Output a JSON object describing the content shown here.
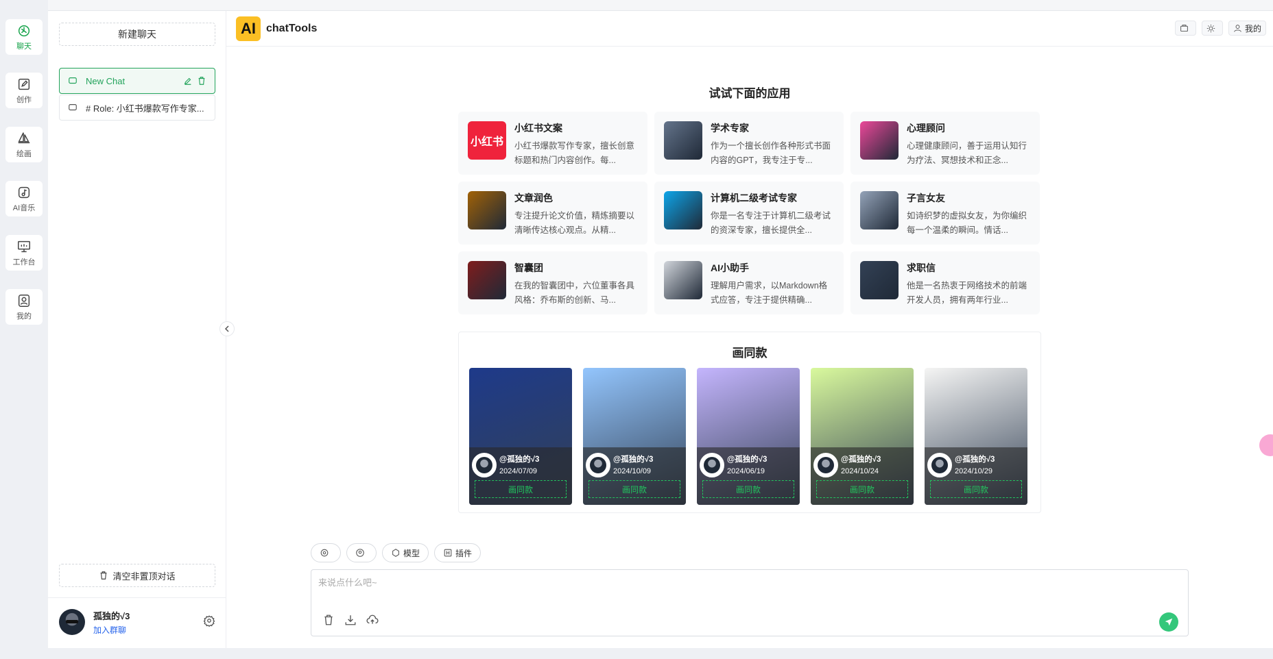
{
  "rail": {
    "items": [
      {
        "label": "聊天",
        "icon": "openai-chat-icon"
      },
      {
        "label": "创作",
        "icon": "edit-icon"
      },
      {
        "label": "绘画",
        "icon": "sailboat-icon"
      },
      {
        "label": "AI音乐",
        "icon": "music-note-icon"
      },
      {
        "label": "工作台",
        "icon": "dashboard-icon"
      },
      {
        "label": "我的",
        "icon": "user-icon"
      }
    ],
    "accent": "#16a34a"
  },
  "sidebar": {
    "new_chat": "新建聊天",
    "chats": [
      {
        "title": "New Chat",
        "active": true
      },
      {
        "title": "# Role: 小红书爆款写作专家..."
      }
    ],
    "clear_label": "清空非置顶对话",
    "user": {
      "name": "孤独的√3",
      "link": "加入群聊"
    }
  },
  "header": {
    "logo": "AI",
    "title": "chatTools",
    "actions": [
      {
        "label": ""
      },
      {
        "label": ""
      },
      {
        "label": "我的"
      }
    ]
  },
  "apps": {
    "title": "试试下面的应用",
    "items": [
      {
        "name": "小红书文案",
        "desc": "小红书爆款写作专家，擅长创意标题和热门内容创作。每...",
        "logo_text": "小红书",
        "color": "#ef233c"
      },
      {
        "name": "学术专家",
        "desc": "作为一个擅长创作各种形式书面内容的GPT，我专注于专...",
        "color": "#64748b"
      },
      {
        "name": "心理顾问",
        "desc": "心理健康顾问，善于运用认知行为疗法、冥想技术和正念...",
        "color": "#ec4899"
      },
      {
        "name": "文章润色",
        "desc": "专注提升论文价值，精炼摘要以清晰传达核心观点。从精...",
        "color": "#a16207"
      },
      {
        "name": "计算机二级考试专家",
        "desc": "你是一名专注于计算机二级考试的资深专家，擅长提供全...",
        "color": "#0ea5e9"
      },
      {
        "name": "子言女友",
        "desc": "如诗织梦的虚拟女友，为你编织每一个温柔的瞬间。情话...",
        "color": "#94a3b8"
      },
      {
        "name": "智囊团",
        "desc": "在我的智囊团中，六位董事各具风格：乔布斯的创新、马...",
        "color": "#7f1d1d"
      },
      {
        "name": "AI小助手",
        "desc": "理解用户需求，以Markdown格式应答，专注于提供精确...",
        "color": "#d1d5db"
      },
      {
        "name": "求职信",
        "desc": "他是一名热衷于网络技术的前端开发人员，拥有两年行业...",
        "color": "#334155"
      }
    ]
  },
  "gallery": {
    "title": "画同款",
    "button_label": "画同款",
    "items": [
      {
        "author": "@孤独的√3",
        "date": "2024/07/09",
        "bg": "#1e3a8a"
      },
      {
        "author": "@孤独的√3",
        "date": "2024/10/09",
        "bg": "#93c5fd"
      },
      {
        "author": "@孤独的√3",
        "date": "2024/06/19",
        "bg": "#c4b5fd"
      },
      {
        "author": "@孤独的√3",
        "date": "2024/10/24",
        "bg": "#d9f99d"
      },
      {
        "author": "@孤独的√3",
        "date": "2024/10/29",
        "bg": "#f5f5f4"
      }
    ]
  },
  "composer": {
    "tools": [
      {
        "label": ""
      },
      {
        "label": ""
      },
      {
        "label": "模型"
      },
      {
        "label": "插件"
      }
    ],
    "placeholder": "来说点什么吧~",
    "value": ""
  }
}
